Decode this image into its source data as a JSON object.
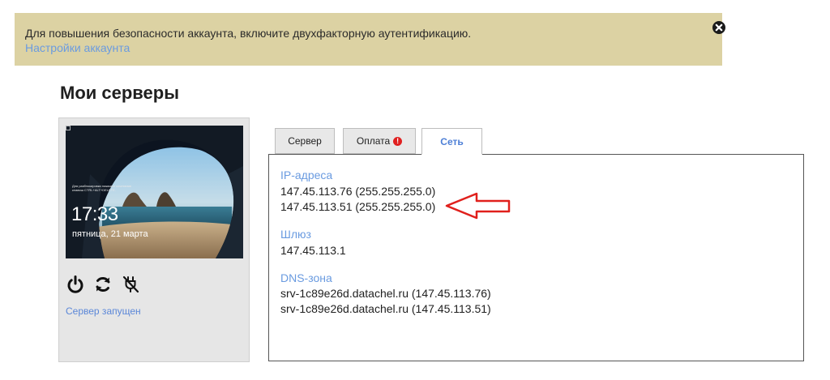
{
  "alert": {
    "message": "Для повышения безопасности аккаунта, включите двухфакторную аутентификацию.",
    "link_label": "Настройки аккаунта",
    "background": "#dcd2a3"
  },
  "page": {
    "title": "Мои серверы"
  },
  "server": {
    "screen": {
      "hint_text": "Для разблокировки нажмите сочетание клавиш CTRL+ALT+DELETE.",
      "time": "17:33",
      "date": "пятница, 21 марта"
    },
    "controls": [
      {
        "name": "power-icon"
      },
      {
        "name": "restart-icon"
      },
      {
        "name": "unplug-icon"
      }
    ],
    "status": "Сервер запущен"
  },
  "tabs": [
    {
      "label": "Сервер",
      "active": false
    },
    {
      "label": "Оплата",
      "active": false,
      "badge": "!"
    },
    {
      "label": "Сеть",
      "active": true
    }
  ],
  "network": {
    "ip": {
      "title": "IP-адреса",
      "lines": [
        "147.45.113.76 (255.255.255.0)",
        "147.45.113.51 (255.255.255.0)"
      ]
    },
    "gateway": {
      "title": "Шлюз",
      "lines": [
        "147.45.113.1"
      ]
    },
    "dns": {
      "title": "DNS-зона",
      "lines": [
        "srv-1c89e26d.datachel.ru (147.45.113.76)",
        "srv-1c89e26d.datachel.ru (147.45.113.51)"
      ]
    }
  },
  "colors": {
    "accent_link": "#6a9be0",
    "active_tab_text": "#4d7fd6",
    "badge": "#e02020",
    "annotation_arrow": "#e0201c"
  }
}
